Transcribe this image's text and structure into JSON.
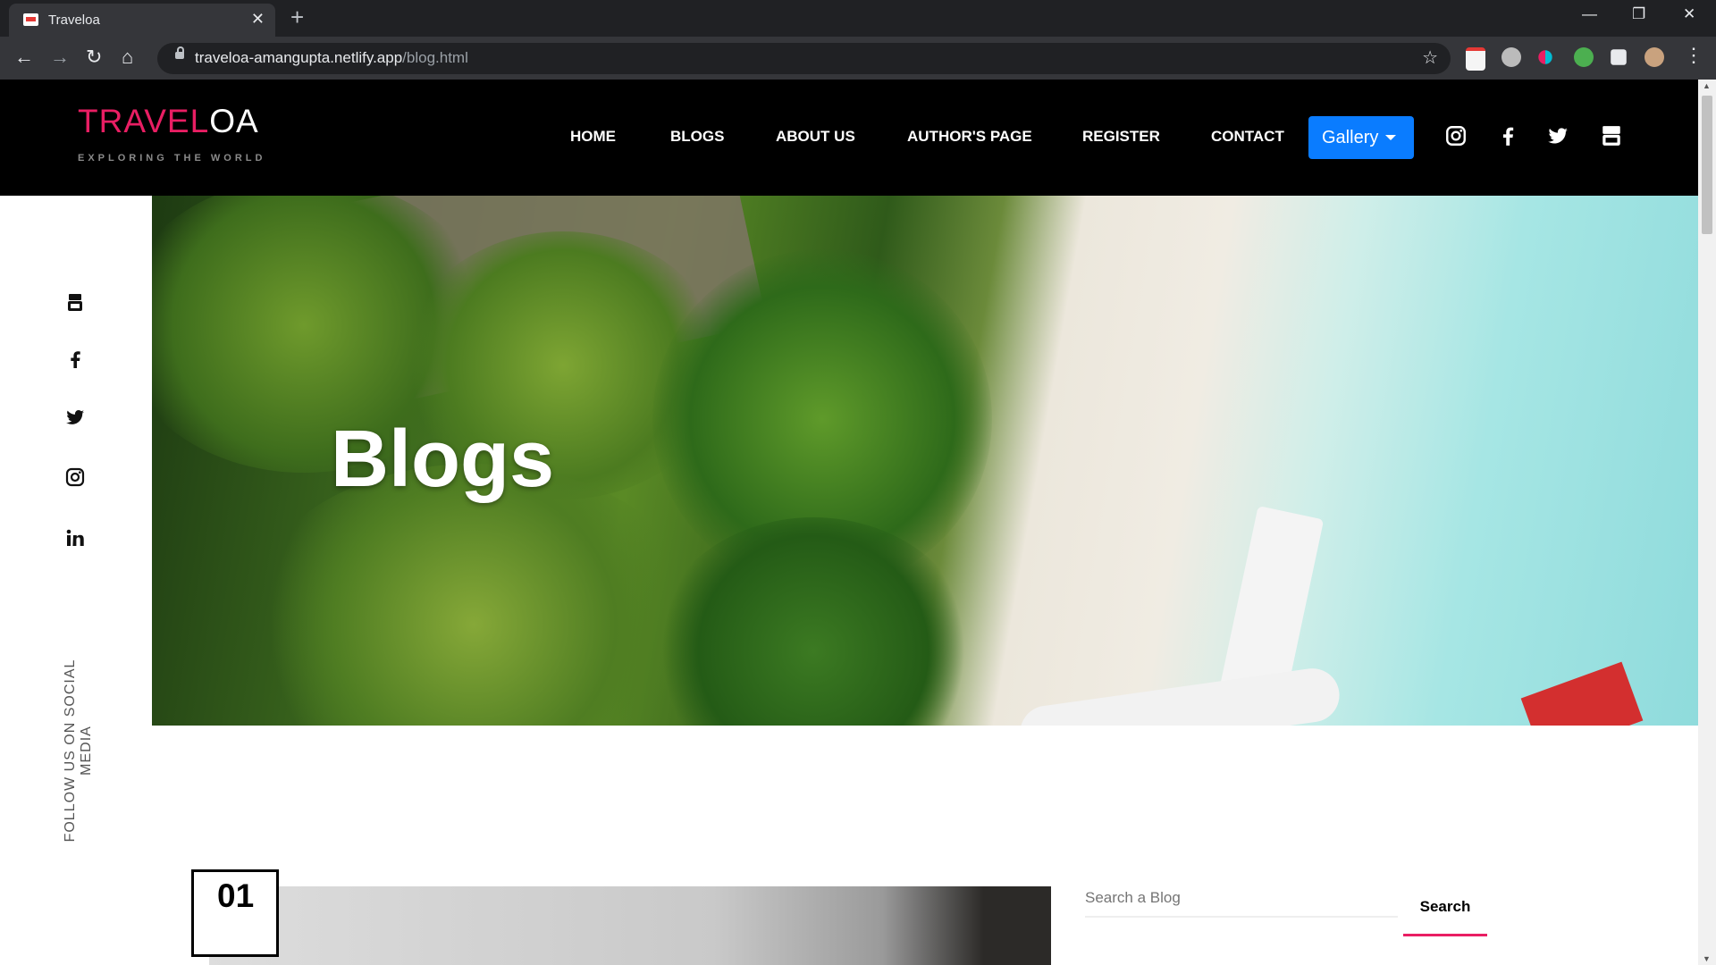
{
  "browser": {
    "tab_title": "Traveloa",
    "url_host": "traveloa-amangupta.netlify.app",
    "url_path": "/blog.html"
  },
  "site": {
    "logo_part1": "TRAVEL",
    "logo_part2": "OA",
    "tagline": "EXPLORING THE WORLD",
    "nav": [
      "HOME",
      "BLOGS",
      "ABOUT US",
      "AUTHOR'S PAGE",
      "REGISTER",
      "CONTACT"
    ],
    "gallery_label": "Gallery",
    "accent": "#e91e63",
    "button_blue": "#0a7cff"
  },
  "sidebar": {
    "follow_text": "FOLLOW US ON SOCIAL MEDIA"
  },
  "hero": {
    "title": "Blogs"
  },
  "blog": {
    "number": "01",
    "search_placeholder": "Search a Blog",
    "search_button": "Search"
  }
}
